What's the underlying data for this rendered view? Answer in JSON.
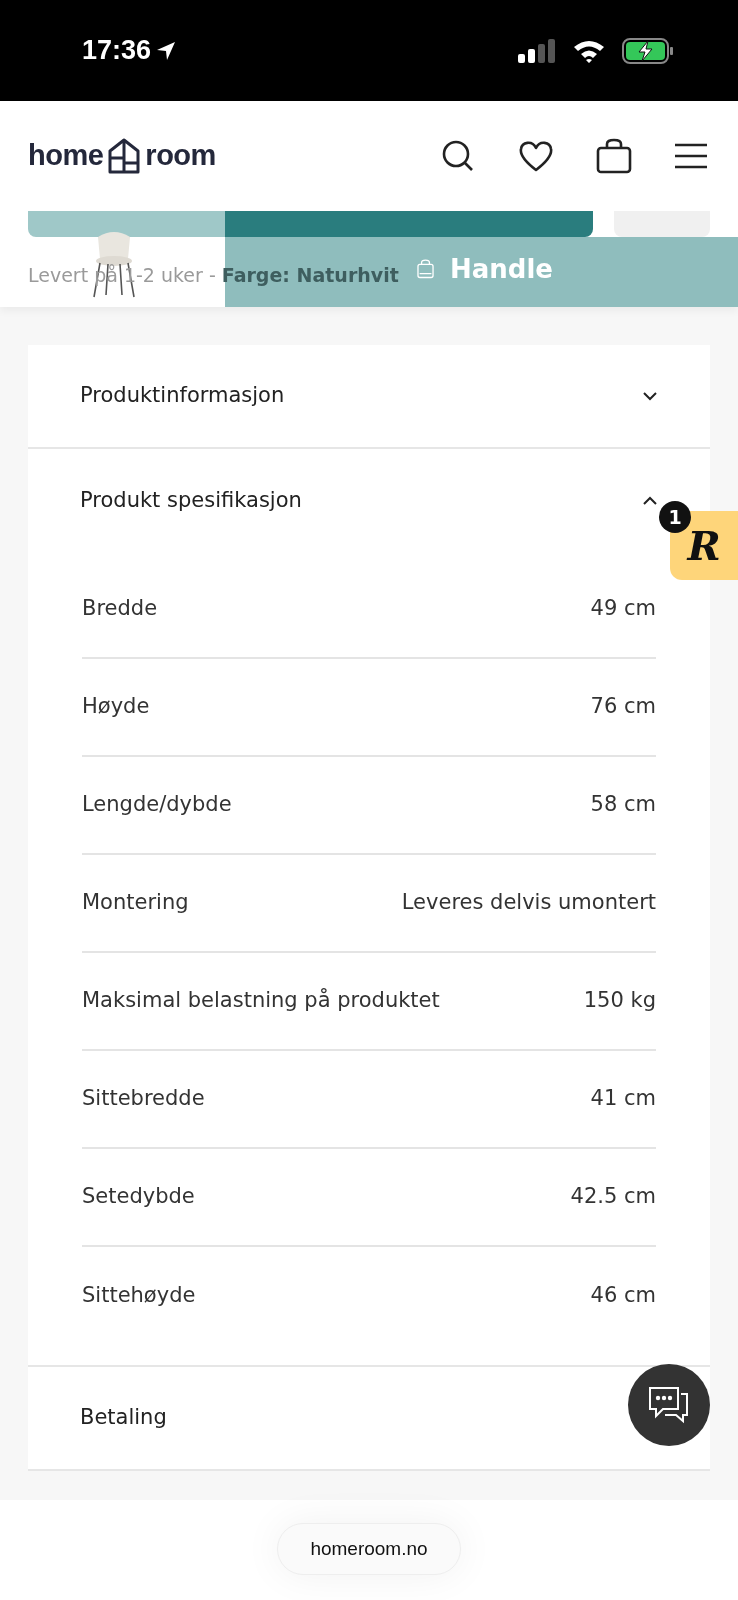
{
  "status_bar": {
    "time": "17:36"
  },
  "header": {
    "logo_left": "home",
    "logo_right": "room"
  },
  "sticky_bar": {
    "delivery": "Levert på 1-2 uker - **Farge: Naturhvit**",
    "buy_button": "Handle"
  },
  "accordion": [
    {
      "title": "Produktinformasjon",
      "expanded": false
    },
    {
      "title": "Produkt spesifikasjon",
      "expanded": true,
      "specs": [
        {
          "label": "Bredde",
          "value": "49 cm"
        },
        {
          "label": "Høyde",
          "value": "76 cm"
        },
        {
          "label": "Lengde/dybde",
          "value": "58 cm"
        },
        {
          "label": "Montering",
          "value": "Leveres delvis umontert"
        },
        {
          "label": "Maksimal belastning på produktet",
          "value": "150 kg"
        },
        {
          "label": "Sittebredde",
          "value": "41 cm"
        },
        {
          "label": "Setedybde",
          "value": "42.5 cm"
        },
        {
          "label": "Sittehøyde",
          "value": "46 cm"
        }
      ]
    },
    {
      "title": "Betaling"
    }
  ],
  "review_badge": {
    "count": "1",
    "letter": "R"
  },
  "url_bar": {
    "url": "homeroom.no"
  }
}
